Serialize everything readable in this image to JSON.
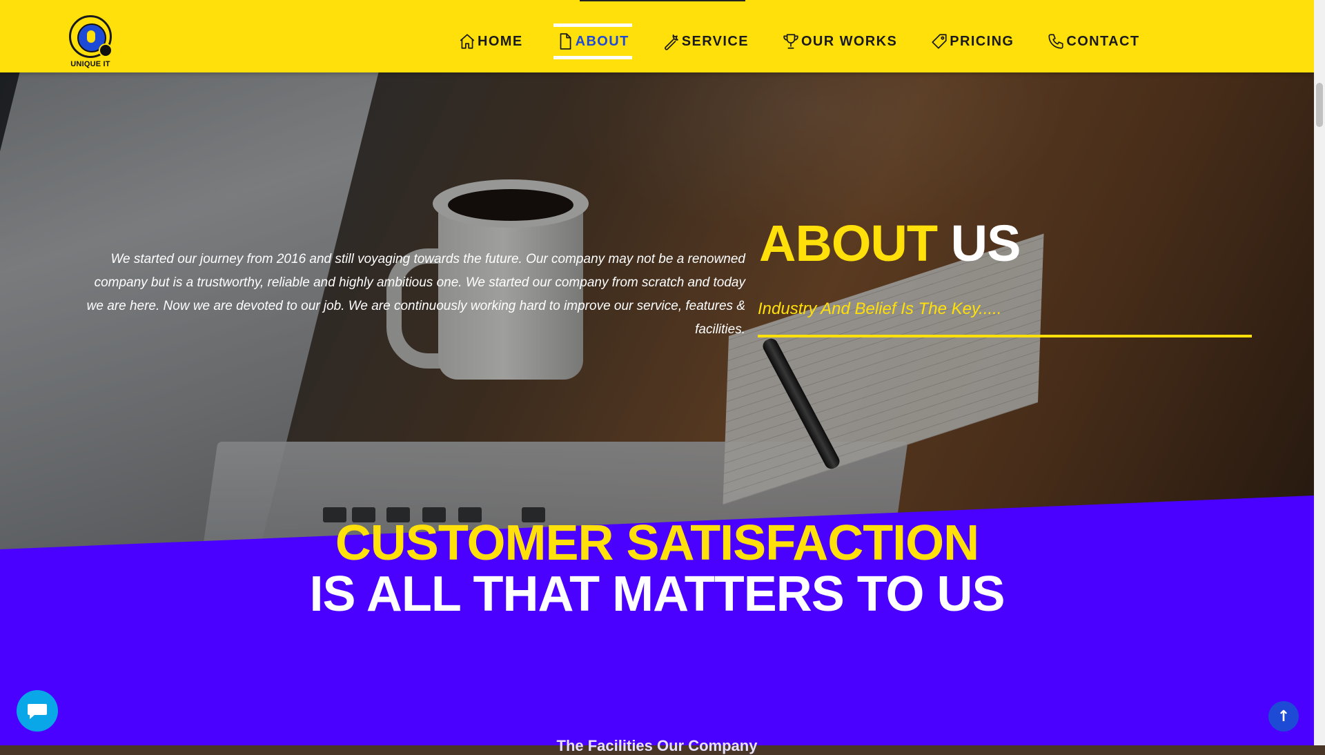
{
  "brand": {
    "logo_text": "UNIQUE IT"
  },
  "nav": {
    "items": [
      {
        "label": "HOME",
        "icon": "home-icon"
      },
      {
        "label": "ABOUT",
        "icon": "document-icon",
        "active": true
      },
      {
        "label": "SERVICE",
        "icon": "wrench-icon"
      },
      {
        "label": "OUR WORKS",
        "icon": "trophy-icon"
      },
      {
        "label": "PRICING",
        "icon": "tag-icon"
      },
      {
        "label": "CONTACT",
        "icon": "phone-icon"
      }
    ]
  },
  "about": {
    "title_part1": "ABOUT",
    "title_part2": "US",
    "subtitle": "Industry And Belief Is The Key.....",
    "body": "We started our journey from 2016 and still voyaging towards the future. Our company may not be a renowned company but is a trustworthy, reliable and highly ambitious one. We started our company from scratch and today we are here. Now we are devoted to our job. We are continuously working hard to improve our service, features & facilities."
  },
  "banner": {
    "line1": "CUSTOMER SATISFACTION",
    "line2": "IS ALL THAT MATTERS TO US"
  },
  "next_section": {
    "heading": "The Facilities Our Company"
  },
  "colors": {
    "header_bg": "#ffe00a",
    "accent_yellow": "#ffe00a",
    "active_nav": "#1d4bd6",
    "purple_band": "#4a01ff",
    "chat_button": "#0aa7e8",
    "top_button": "#1d4bd6"
  },
  "floating": {
    "chat_icon": "chat-bubble-icon",
    "top_icon": "arrow-up-icon",
    "top_label": "↑"
  }
}
